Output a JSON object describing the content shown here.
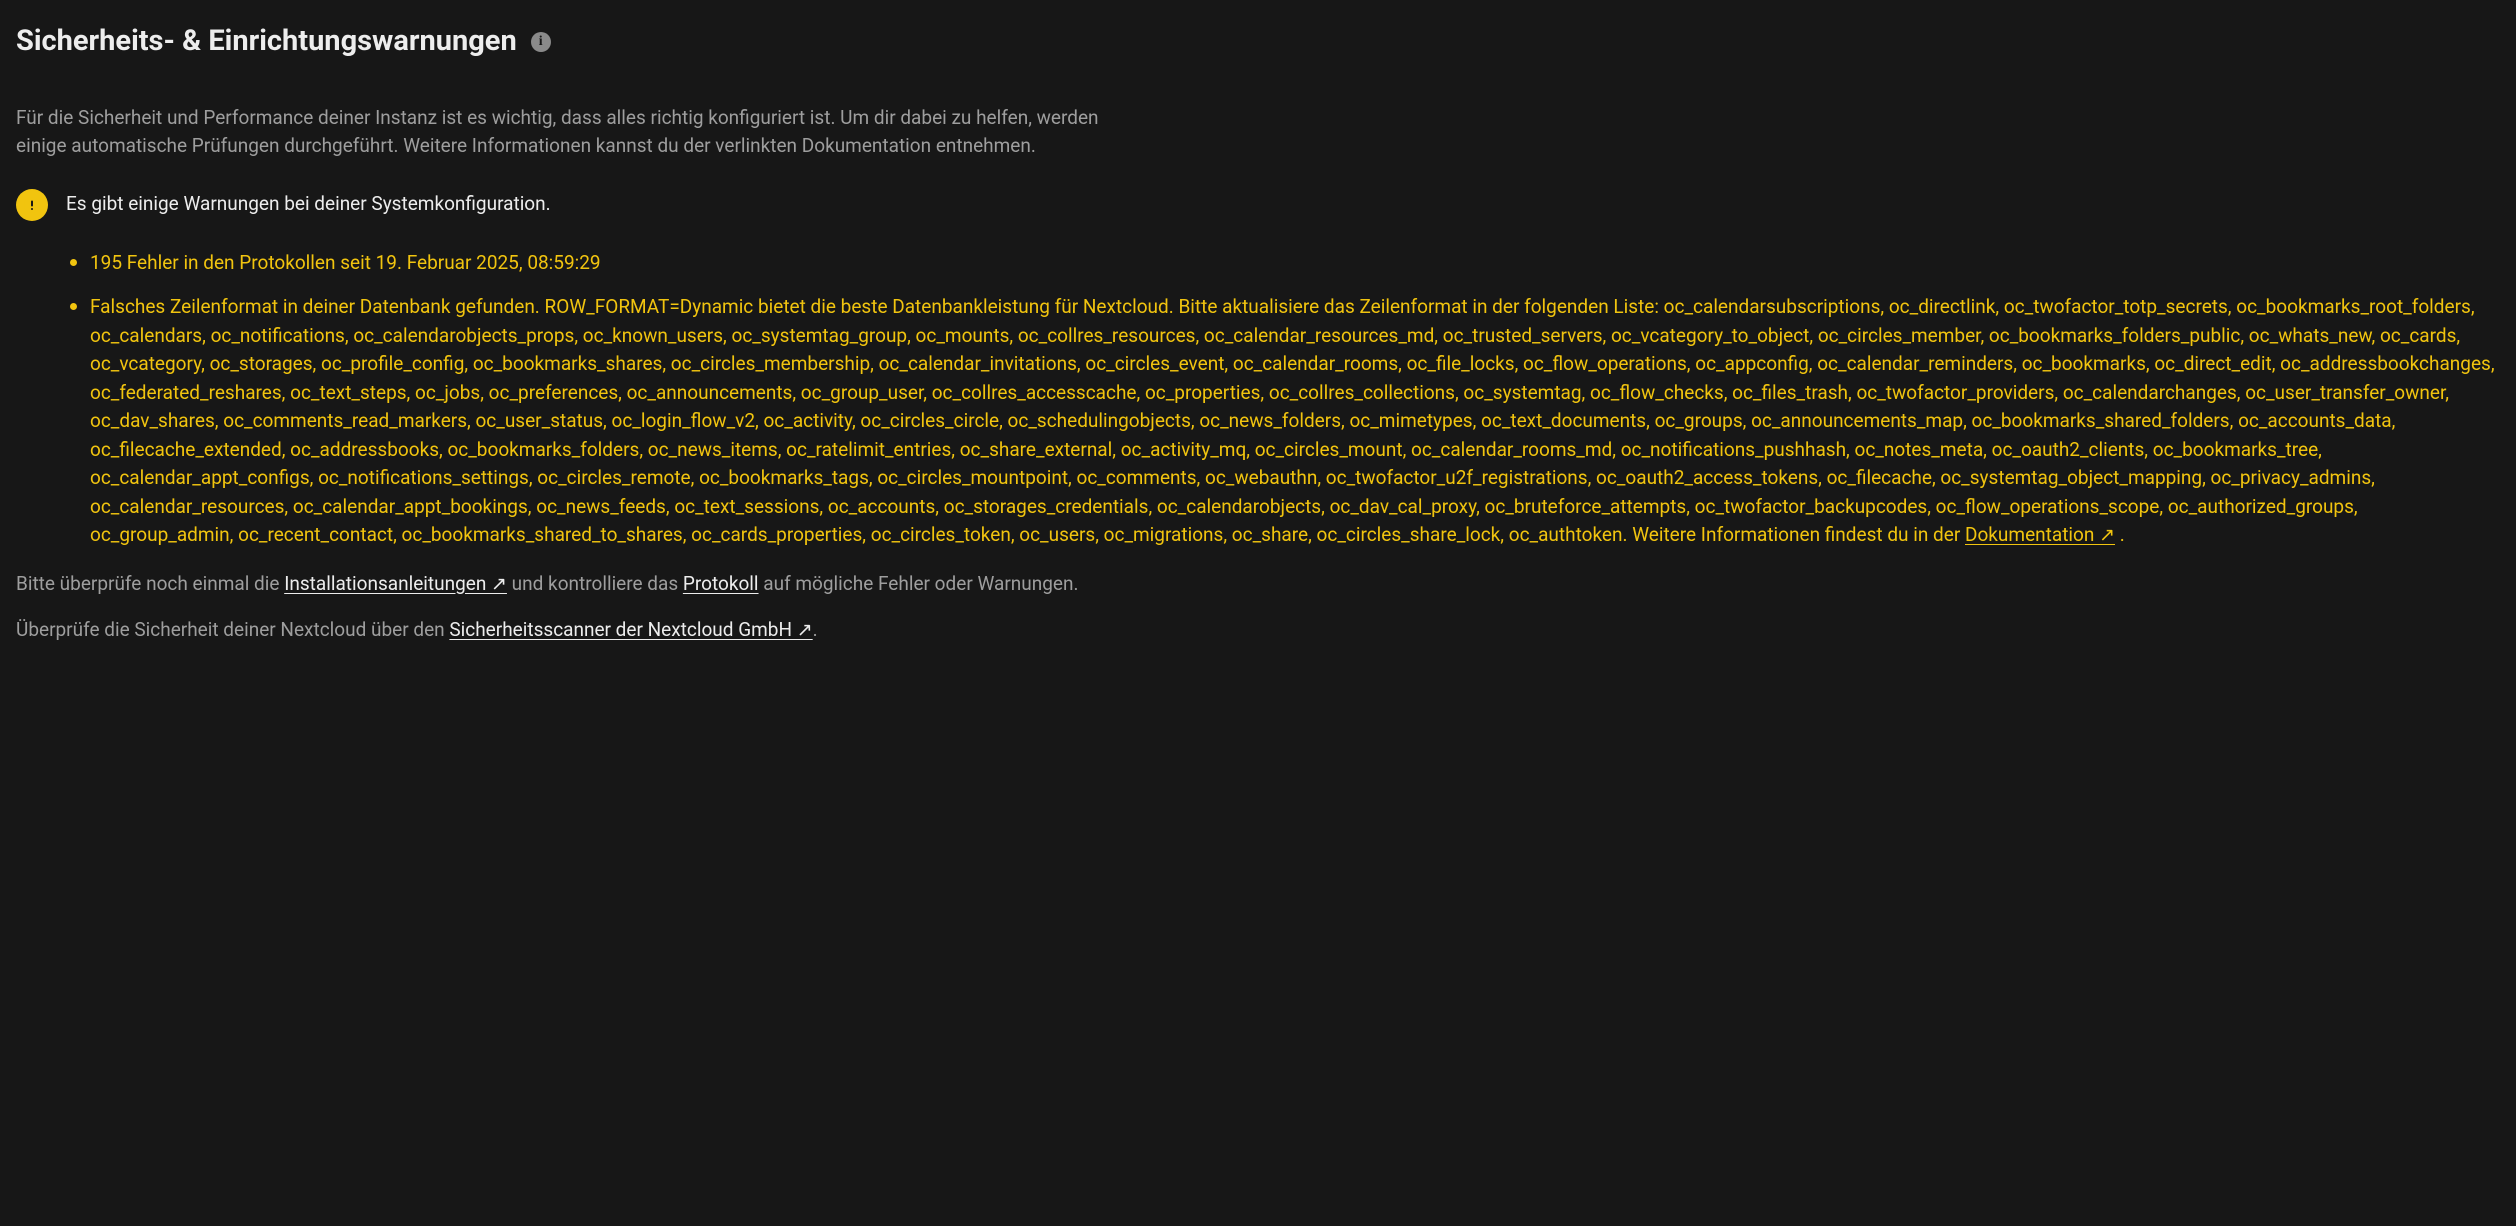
{
  "heading": "Sicherheits- & Einrichtungswarnungen",
  "intro": "Für die Sicherheit und Performance deiner Instanz ist es wichtig, dass alles richtig konfiguriert ist. Um dir dabei zu helfen, werden einige automatische Prüfungen durchgeführt. Weitere Informationen kannst du der verlinkten Dokumentation entnehmen.",
  "summary": "Es gibt einige Warnungen bei deiner Systemkonfiguration.",
  "warnings": {
    "item0": "195 Fehler in den Protokollen seit 19. Februar 2025, 08:59:29",
    "item1_pre": "Falsches Zeilenformat in deiner Datenbank gefunden. ROW_FORMAT=Dynamic bietet die beste Datenbankleistung für Nextcloud. Bitte aktualisiere das Zeilenformat in der folgenden Liste: oc_calendarsubscriptions, oc_directlink, oc_twofactor_totp_secrets, oc_bookmarks_root_folders, oc_calendars, oc_notifications, oc_calendarobjects_props, oc_known_users, oc_systemtag_group, oc_mounts, oc_collres_resources, oc_calendar_resources_md, oc_trusted_servers, oc_vcategory_to_object, oc_circles_member, oc_bookmarks_folders_public, oc_whats_new, oc_cards, oc_vcategory, oc_storages, oc_profile_config, oc_bookmarks_shares, oc_circles_membership, oc_calendar_invitations, oc_circles_event, oc_calendar_rooms, oc_file_locks, oc_flow_operations, oc_appconfig, oc_calendar_reminders, oc_bookmarks, oc_direct_edit, oc_addressbookchanges, oc_federated_reshares, oc_text_steps, oc_jobs, oc_preferences, oc_announcements, oc_group_user, oc_collres_accesscache, oc_properties, oc_collres_collections, oc_systemtag, oc_flow_checks, oc_files_trash, oc_twofactor_providers, oc_calendarchanges, oc_user_transfer_owner, oc_dav_shares, oc_comments_read_markers, oc_user_status, oc_login_flow_v2, oc_activity, oc_circles_circle, oc_schedulingobjects, oc_news_folders, oc_mimetypes, oc_text_documents, oc_groups, oc_announcements_map, oc_bookmarks_shared_folders, oc_accounts_data, oc_filecache_extended, oc_addressbooks, oc_bookmarks_folders, oc_news_items, oc_ratelimit_entries, oc_share_external, oc_activity_mq, oc_circles_mount, oc_calendar_rooms_md, oc_notifications_pushhash, oc_notes_meta, oc_oauth2_clients, oc_bookmarks_tree, oc_calendar_appt_configs, oc_notifications_settings, oc_circles_remote, oc_bookmarks_tags, oc_circles_mountpoint, oc_comments, oc_webauthn, oc_twofactor_u2f_registrations, oc_oauth2_access_tokens, oc_filecache, oc_systemtag_object_mapping, oc_privacy_admins, oc_calendar_resources, oc_calendar_appt_bookings, oc_news_feeds, oc_text_sessions, oc_accounts, oc_storages_credentials, oc_calendarobjects, oc_dav_cal_proxy, oc_bruteforce_attempts, oc_twofactor_backupcodes, oc_flow_operations_scope, oc_authorized_groups, oc_group_admin, oc_recent_contact, oc_bookmarks_shared_to_shares, oc_cards_properties, oc_circles_token, oc_users, oc_migrations, oc_share, oc_circles_share_lock, oc_authtoken. Weitere Informationen findest du in der ",
    "item1_link": "Dokumentation ↗",
    "item1_post": " ."
  },
  "footer1": {
    "pre": "Bitte überprüfe noch einmal die ",
    "link1": "Installationsanleitungen ↗",
    "mid": " und kontrolliere das ",
    "link2": "Protokoll",
    "post": " auf mögliche Fehler oder Warnungen."
  },
  "footer2": {
    "pre": "Überprüfe die Sicherheit deiner Nextcloud über den ",
    "link": "Sicherheitsscanner der Nextcloud GmbH ↗",
    "post": "."
  }
}
